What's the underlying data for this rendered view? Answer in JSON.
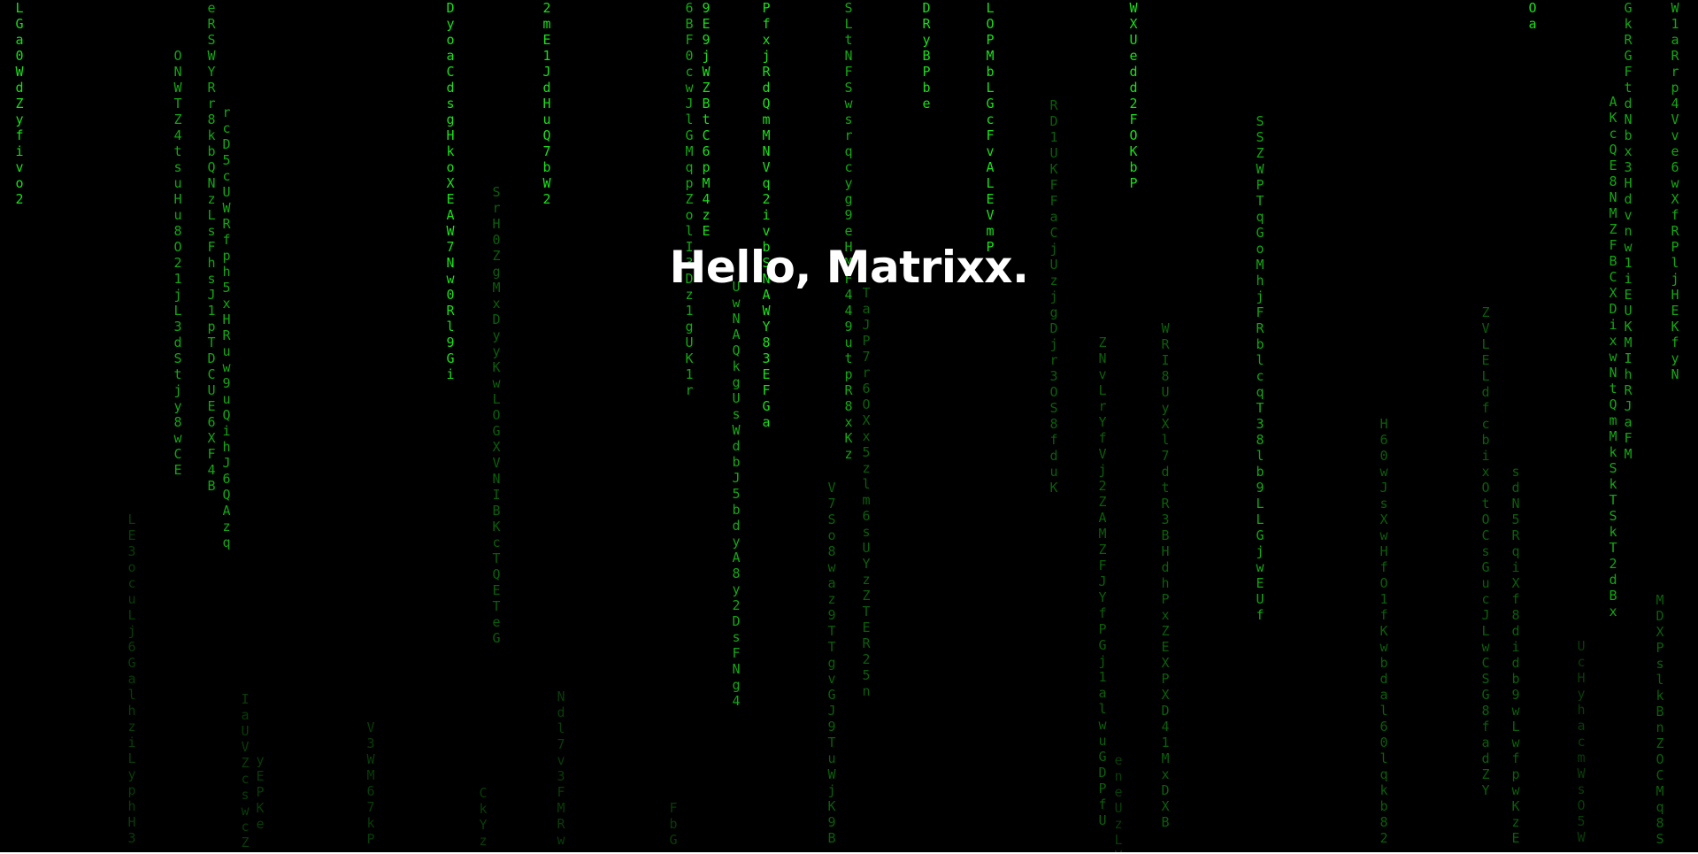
{
  "headline": "Hello, Matrixx.",
  "colors": {
    "background": "#000000",
    "headline": "#ffffff",
    "bright": "#18e018",
    "mid": "#12a812",
    "dim": "#0a5f0a",
    "faint": "#073d07"
  },
  "columns": [
    {
      "chars": "LGa0WdZyfivo2",
      "tone": "bright"
    },
    {
      "chars": "LE3ocuLj6GalhziLyphH3",
      "tone": "faint"
    },
    {
      "chars": "ONWTZ4tsuHu8O21jL3dStjy8wCE",
      "tone": "mid"
    },
    {
      "chars": "eRSWYRr8kbQNzLsFhsJ1pTDCUE6XF4B",
      "tone": "mid"
    },
    {
      "chars": "rcD5cUWRfph5xHRuw9uQihJ6QAzq",
      "tone": "mid"
    },
    {
      "chars": "IaUVZcswcZ",
      "tone": "faint"
    },
    {
      "chars": "yEPKe",
      "tone": "faint"
    },
    {
      "chars": "V3WM67kP",
      "tone": "faint"
    },
    {
      "chars": "DyoaCdsgHkoXEAW7Nw0Rl9Gi",
      "tone": "bright"
    },
    {
      "chars": "CkYzr",
      "tone": "faint"
    },
    {
      "chars": "SrH0ZgMxDyyKwLOGXVNIBKcTQETeG",
      "tone": "dim"
    },
    {
      "chars": "2mE1JdHuQ7bW2",
      "tone": "bright"
    },
    {
      "chars": "Ndl7v3FMRw",
      "tone": "faint"
    },
    {
      "chars": "FbG",
      "tone": "faint"
    },
    {
      "chars": "6BF0cwJlGMqpZolI3Dz1gUK1r",
      "tone": "mid"
    },
    {
      "chars": "9E9jWZBtC6pM4zE",
      "tone": "bright"
    },
    {
      "chars": "UwNAQkgUsWdbJ5bdyA8y2DsFNg4",
      "tone": "mid"
    },
    {
      "chars": "PfxjRdQmMNVq2ivbSNAWY83EFGa",
      "tone": "bright"
    },
    {
      "chars": "V7So8waz9TTgvGJ9TuWjK9B",
      "tone": "dim"
    },
    {
      "chars": "SLtNFSwsrqcyg9eHMF449utpR8xKz",
      "tone": "mid"
    },
    {
      "chars": "TaJP7r6OXx5zlm6sUYzZTER25n",
      "tone": "dim"
    },
    {
      "chars": "DRyBPbe",
      "tone": "bright"
    },
    {
      "chars": "LOPMbLGcFvALEVmP",
      "tone": "bright"
    },
    {
      "chars": "RD1UKFFaCjUzjgDjr3OS8fduK",
      "tone": "dim"
    },
    {
      "chars": "ZNvLrYfVj2ZAMZFJYfPGj1alwuGDPfU",
      "tone": "dim"
    },
    {
      "chars": "eneUzLV",
      "tone": "faint"
    },
    {
      "chars": "WXUedd2FOKbP",
      "tone": "bright"
    },
    {
      "chars": "WRI8UyXl7dtR3BHdhPxZEXPXD41MxDXB",
      "tone": "dim"
    },
    {
      "chars": "SSZWPTqGoMhjFRblcqT38lb9LLGjwEUf",
      "tone": "mid"
    },
    {
      "chars": "H60wJsXwHfO1fKwbdal60lqkb82",
      "tone": "dim"
    },
    {
      "chars": "ZVLELdfcbixOtOCsGucJLwCSG8fadZY",
      "tone": "dim"
    },
    {
      "chars": "sdN5RqiXf8didb9wLwfpwKzE",
      "tone": "dim"
    },
    {
      "chars": "Oa",
      "tone": "bright"
    },
    {
      "chars": "UcHyhacmWsO5W",
      "tone": "faint"
    },
    {
      "chars": "AKcQE8NMZFBCXDixwNtQmMkSkTSkT2dBx",
      "tone": "mid"
    },
    {
      "chars": "GkRGFtdNbx3Hdvnw1iEUKMIhRJaFM",
      "tone": "mid"
    },
    {
      "chars": "MDXPslkBnZOCMq8S",
      "tone": "dim"
    },
    {
      "chars": "W1aRrp4Vve6wXfRPljHEKfyN",
      "tone": "mid"
    }
  ]
}
